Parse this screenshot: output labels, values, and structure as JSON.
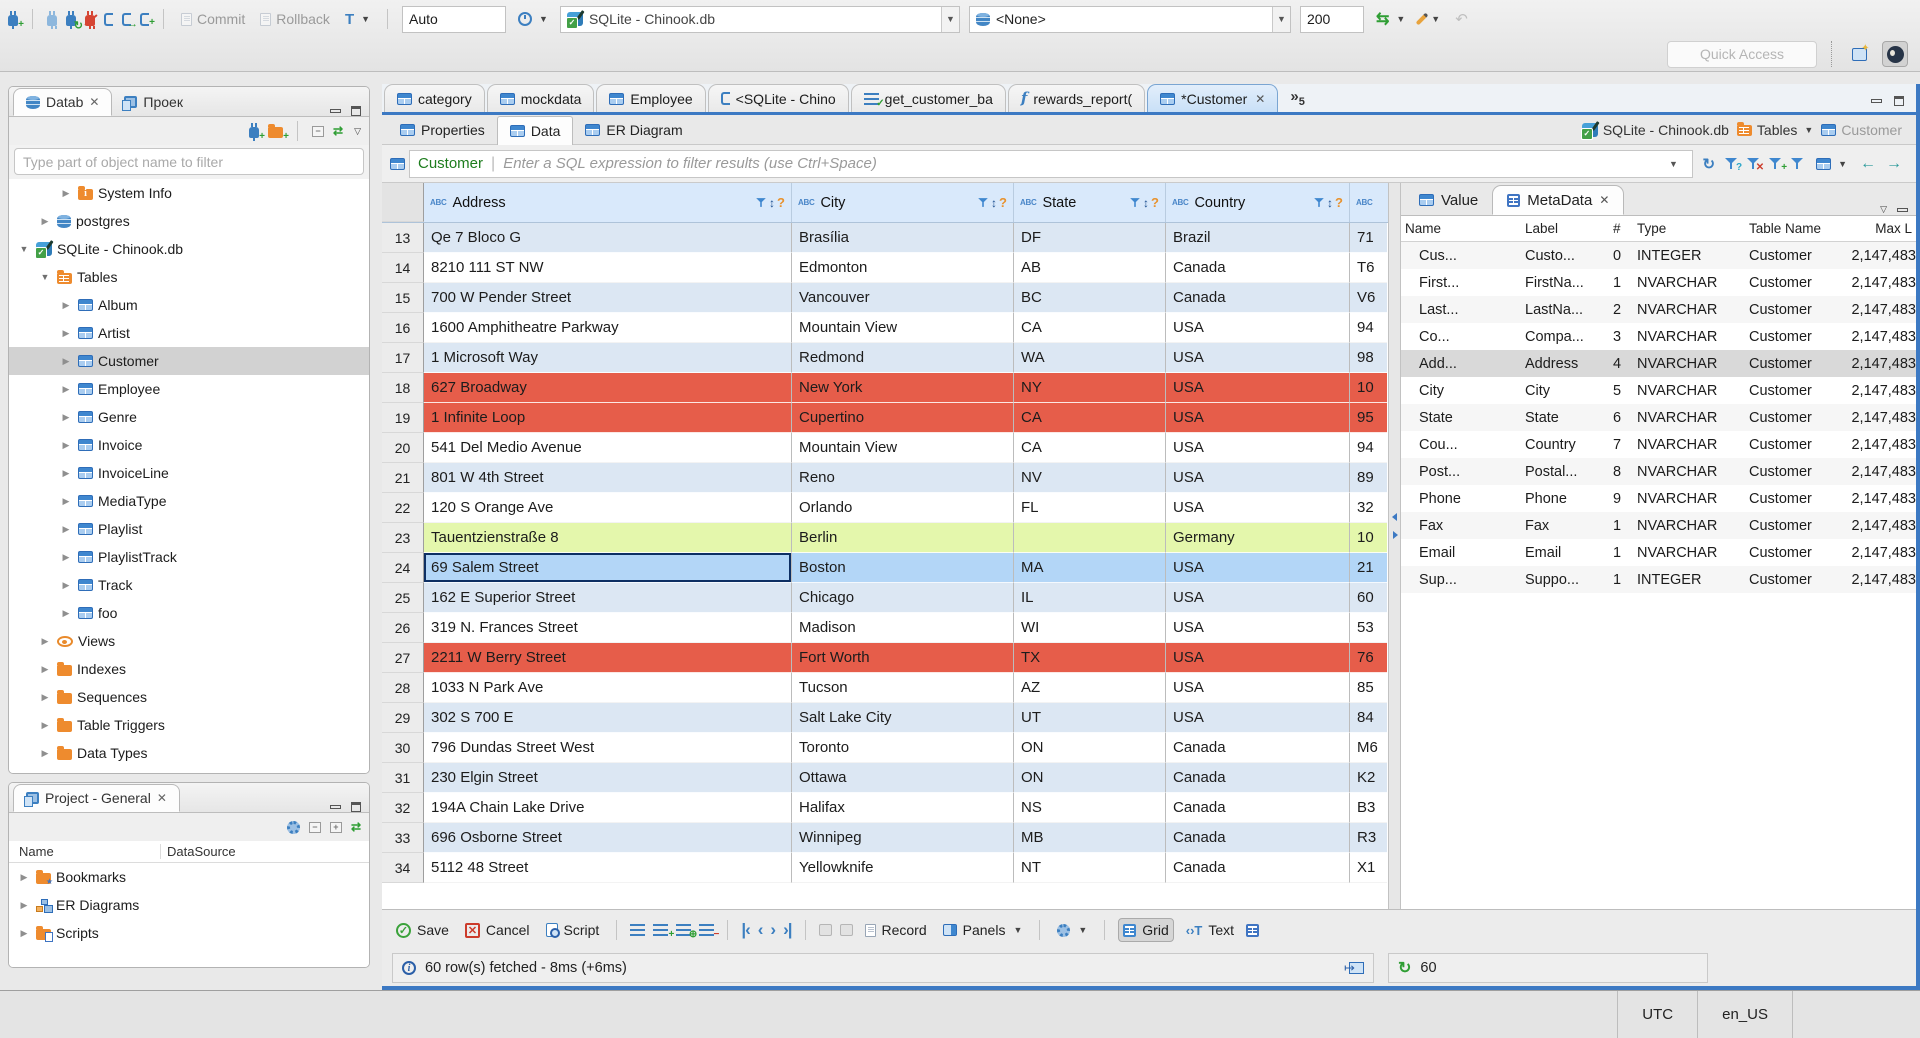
{
  "colors": {
    "accent_blue": "#3c79c3",
    "row_red": "#e65d4a",
    "row_green": "#e4f7ac",
    "row_selected": "#b3d6f7",
    "row_stripe": "#dce7f3",
    "grid_header": "#d9e9fb"
  },
  "top_toolbar": {
    "commit_label": "Commit",
    "rollback_label": "Rollback",
    "auto_label": "Auto",
    "connection_value": "SQLite - Chinook.db",
    "schema_value": "<None>",
    "fetch_size_value": "200",
    "quick_access_placeholder": "Quick Access"
  },
  "navigator": {
    "db_tab_label": "Datab",
    "project_tab_label": "Проек",
    "filter_placeholder": "Type part of object name to filter",
    "tree": [
      {
        "label": "System Info",
        "lv": 2,
        "exp": "c",
        "ic": "folder-info"
      },
      {
        "label": "postgres",
        "lv": 1,
        "exp": "c",
        "ic": "db"
      },
      {
        "label": "SQLite - Chinook.db",
        "lv": 0,
        "exp": "o",
        "ic": "db-ok"
      },
      {
        "label": "Tables",
        "lv": 1,
        "exp": "o",
        "ic": "folder-table"
      },
      {
        "label": "Album",
        "lv": 2,
        "exp": "c",
        "ic": "table"
      },
      {
        "label": "Artist",
        "lv": 2,
        "exp": "c",
        "ic": "table"
      },
      {
        "label": "Customer",
        "lv": 2,
        "exp": "c",
        "ic": "table",
        "sel": "y"
      },
      {
        "label": "Employee",
        "lv": 2,
        "exp": "c",
        "ic": "table"
      },
      {
        "label": "Genre",
        "lv": 2,
        "exp": "c",
        "ic": "table"
      },
      {
        "label": "Invoice",
        "lv": 2,
        "exp": "c",
        "ic": "table"
      },
      {
        "label": "InvoiceLine",
        "lv": 2,
        "exp": "c",
        "ic": "table"
      },
      {
        "label": "MediaType",
        "lv": 2,
        "exp": "c",
        "ic": "table"
      },
      {
        "label": "Playlist",
        "lv": 2,
        "exp": "c",
        "ic": "table"
      },
      {
        "label": "PlaylistTrack",
        "lv": 2,
        "exp": "c",
        "ic": "table"
      },
      {
        "label": "Track",
        "lv": 2,
        "exp": "c",
        "ic": "table"
      },
      {
        "label": "foo",
        "lv": 2,
        "exp": "c",
        "ic": "table"
      },
      {
        "label": "Views",
        "lv": 1,
        "exp": "c",
        "ic": "eye"
      },
      {
        "label": "Indexes",
        "lv": 1,
        "exp": "c",
        "ic": "folder"
      },
      {
        "label": "Sequences",
        "lv": 1,
        "exp": "c",
        "ic": "folder"
      },
      {
        "label": "Table Triggers",
        "lv": 1,
        "exp": "c",
        "ic": "folder"
      },
      {
        "label": "Data Types",
        "lv": 1,
        "exp": "c",
        "ic": "folder"
      }
    ]
  },
  "project_panel": {
    "title": "Project - General",
    "columns": {
      "name": "Name",
      "datasource": "DataSource"
    },
    "items": [
      {
        "label": "Bookmarks",
        "exp": "c",
        "ic": "folder-bm"
      },
      {
        "label": "ER Diagrams",
        "exp": "c",
        "ic": "er"
      },
      {
        "label": "Scripts",
        "exp": "c",
        "ic": "folder-s"
      }
    ]
  },
  "editor": {
    "tabs": [
      {
        "label": "category",
        "ic": "table"
      },
      {
        "label": "mockdata",
        "ic": "table"
      },
      {
        "label": "Employee",
        "ic": "table"
      },
      {
        "label": "<SQLite - Chino",
        "ic": "sql"
      },
      {
        "label": "get_customer_ba",
        "ic": "sql-check"
      },
      {
        "label": "rewards_report(",
        "ic": "func"
      },
      {
        "label": "*Customer",
        "ic": "table",
        "active": "y",
        "close": "y"
      }
    ],
    "overflow_count": "5",
    "subtabs": [
      {
        "label": "Properties",
        "ic": "table"
      },
      {
        "label": "Data",
        "ic": "table",
        "active": "y"
      },
      {
        "label": "ER Diagram",
        "ic": "er"
      }
    ],
    "breadcrumb": [
      {
        "label": "SQLite - Chinook.db",
        "ic": "db-ok"
      },
      {
        "label": "Tables",
        "ic": "folder-table",
        "caret": "y"
      },
      {
        "label": "Customer",
        "ic": "table",
        "dim": "y"
      }
    ]
  },
  "filter_bar": {
    "table_name": "Customer",
    "placeholder": "Enter a SQL expression to filter results (use Ctrl+Space)"
  },
  "grid": {
    "columns": [
      {
        "label": "Address",
        "cls": "ca"
      },
      {
        "label": "City",
        "cls": "cc"
      },
      {
        "label": "State",
        "cls": "cs"
      },
      {
        "label": "Country",
        "cls": "co"
      }
    ],
    "rows": [
      {
        "n": "13",
        "address": "Qe 7 Bloco G",
        "city": "Brasília",
        "state": "DF",
        "country": "Brazil",
        "postal": "71",
        "color": "stripe"
      },
      {
        "n": "14",
        "address": "8210 111 ST NW",
        "city": "Edmonton",
        "state": "AB",
        "country": "Canada",
        "postal": "T6",
        "color": "white"
      },
      {
        "n": "15",
        "address": "700 W Pender Street",
        "city": "Vancouver",
        "state": "BC",
        "country": "Canada",
        "postal": "V6",
        "color": "stripe"
      },
      {
        "n": "16",
        "address": "1600 Amphitheatre Parkway",
        "city": "Mountain View",
        "state": "CA",
        "country": "USA",
        "postal": "94",
        "color": "white"
      },
      {
        "n": "17",
        "address": "1 Microsoft Way",
        "city": "Redmond",
        "state": "WA",
        "country": "USA",
        "postal": "98",
        "color": "stripe"
      },
      {
        "n": "18",
        "address": "627 Broadway",
        "city": "New York",
        "state": "NY",
        "country": "USA",
        "postal": "10",
        "color": "red"
      },
      {
        "n": "19",
        "address": "1 Infinite Loop",
        "city": "Cupertino",
        "state": "CA",
        "country": "USA",
        "postal": "95",
        "color": "red"
      },
      {
        "n": "20",
        "address": "541 Del Medio Avenue",
        "city": "Mountain View",
        "state": "CA",
        "country": "USA",
        "postal": "94",
        "color": "white"
      },
      {
        "n": "21",
        "address": "801 W 4th Street",
        "city": "Reno",
        "state": "NV",
        "country": "USA",
        "postal": "89",
        "color": "stripe"
      },
      {
        "n": "22",
        "address": "120 S Orange Ave",
        "city": "Orlando",
        "state": "FL",
        "country": "USA",
        "postal": "32",
        "color": "white"
      },
      {
        "n": "23",
        "address": "Tauentzienstraße 8",
        "city": "Berlin",
        "state": "",
        "country": "Germany",
        "postal": "10",
        "color": "green"
      },
      {
        "n": "24",
        "address": "69 Salem Street",
        "city": "Boston",
        "state": "MA",
        "country": "USA",
        "postal": "21",
        "color": "sel",
        "focus": "y"
      },
      {
        "n": "25",
        "address": "162 E Superior Street",
        "city": "Chicago",
        "state": "IL",
        "country": "USA",
        "postal": "60",
        "color": "stripe"
      },
      {
        "n": "26",
        "address": "319 N. Frances Street",
        "city": "Madison",
        "state": "WI",
        "country": "USA",
        "postal": "53",
        "color": "white"
      },
      {
        "n": "27",
        "address": "2211 W Berry Street",
        "city": "Fort Worth",
        "state": "TX",
        "country": "USA",
        "postal": "76",
        "color": "red"
      },
      {
        "n": "28",
        "address": "1033 N Park Ave",
        "city": "Tucson",
        "state": "AZ",
        "country": "USA",
        "postal": "85",
        "color": "white"
      },
      {
        "n": "29",
        "address": "302 S 700 E",
        "city": "Salt Lake City",
        "state": "UT",
        "country": "USA",
        "postal": "84",
        "color": "stripe"
      },
      {
        "n": "30",
        "address": "796 Dundas Street West",
        "city": "Toronto",
        "state": "ON",
        "country": "Canada",
        "postal": "M6",
        "color": "white"
      },
      {
        "n": "31",
        "address": "230 Elgin Street",
        "city": "Ottawa",
        "state": "ON",
        "country": "Canada",
        "postal": "K2",
        "color": "stripe"
      },
      {
        "n": "32",
        "address": "194A Chain Lake Drive",
        "city": "Halifax",
        "state": "NS",
        "country": "Canada",
        "postal": "B3",
        "color": "white"
      },
      {
        "n": "33",
        "address": "696 Osborne Street",
        "city": "Winnipeg",
        "state": "MB",
        "country": "Canada",
        "postal": "R3",
        "color": "stripe"
      },
      {
        "n": "34",
        "address": "5112 48 Street",
        "city": "Yellowknife",
        "state": "NT",
        "country": "Canada",
        "postal": "X1",
        "color": "white"
      }
    ]
  },
  "meta_panel": {
    "value_tab_label": "Value",
    "metadata_tab_label": "MetaData",
    "columns": {
      "name": "Name",
      "label": "Label",
      "num": "#",
      "type": "Type",
      "table": "Table Name",
      "max": "Max L"
    },
    "rows": [
      {
        "ic": "123",
        "name": "Cus...",
        "label": "Custo...",
        "num": "0",
        "type": "INTEGER",
        "table": "Customer",
        "max": "2,147,483"
      },
      {
        "ic": "abc",
        "name": "First...",
        "label": "FirstNa...",
        "num": "1",
        "type": "NVARCHAR",
        "table": "Customer",
        "max": "2,147,483"
      },
      {
        "ic": "abc",
        "name": "Last...",
        "label": "LastNa...",
        "num": "2",
        "type": "NVARCHAR",
        "table": "Customer",
        "max": "2,147,483"
      },
      {
        "ic": "abc",
        "name": "Co...",
        "label": "Compa...",
        "num": "3",
        "type": "NVARCHAR",
        "table": "Customer",
        "max": "2,147,483"
      },
      {
        "ic": "abc",
        "name": "Add...",
        "label": "Address",
        "num": "4",
        "type": "NVARCHAR",
        "table": "Customer",
        "max": "2,147,483",
        "sel": "y"
      },
      {
        "ic": "abc",
        "name": "City",
        "label": "City",
        "num": "5",
        "type": "NVARCHAR",
        "table": "Customer",
        "max": "2,147,483"
      },
      {
        "ic": "abc",
        "name": "State",
        "label": "State",
        "num": "6",
        "type": "NVARCHAR",
        "table": "Customer",
        "max": "2,147,483"
      },
      {
        "ic": "abc",
        "name": "Cou...",
        "label": "Country",
        "num": "7",
        "type": "NVARCHAR",
        "table": "Customer",
        "max": "2,147,483"
      },
      {
        "ic": "abc",
        "name": "Post...",
        "label": "Postal...",
        "num": "8",
        "type": "NVARCHAR",
        "table": "Customer",
        "max": "2,147,483"
      },
      {
        "ic": "abc",
        "name": "Phone",
        "label": "Phone",
        "num": "9",
        "type": "NVARCHAR",
        "table": "Customer",
        "max": "2,147,483"
      },
      {
        "ic": "abc",
        "name": "Fax",
        "label": "Fax",
        "num": "1",
        "type": "NVARCHAR",
        "table": "Customer",
        "max": "2,147,483"
      },
      {
        "ic": "abc",
        "name": "Email",
        "label": "Email",
        "num": "1",
        "type": "NVARCHAR",
        "table": "Customer",
        "max": "2,147,483"
      },
      {
        "ic": "123",
        "name": "Sup...",
        "label": "Suppo...",
        "num": "1",
        "type": "INTEGER",
        "table": "Customer",
        "max": "2,147,483"
      }
    ]
  },
  "bottom_toolbar": {
    "save_label": "Save",
    "cancel_label": "Cancel",
    "script_label": "Script",
    "record_label": "Record",
    "panels_label": "Panels",
    "grid_label": "Grid",
    "text_label": "Text"
  },
  "status": {
    "message": "60 row(s) fetched - 8ms (+6ms)",
    "fetch_count": "60"
  },
  "window_bar": {
    "timezone": "UTC",
    "locale": "en_US"
  }
}
